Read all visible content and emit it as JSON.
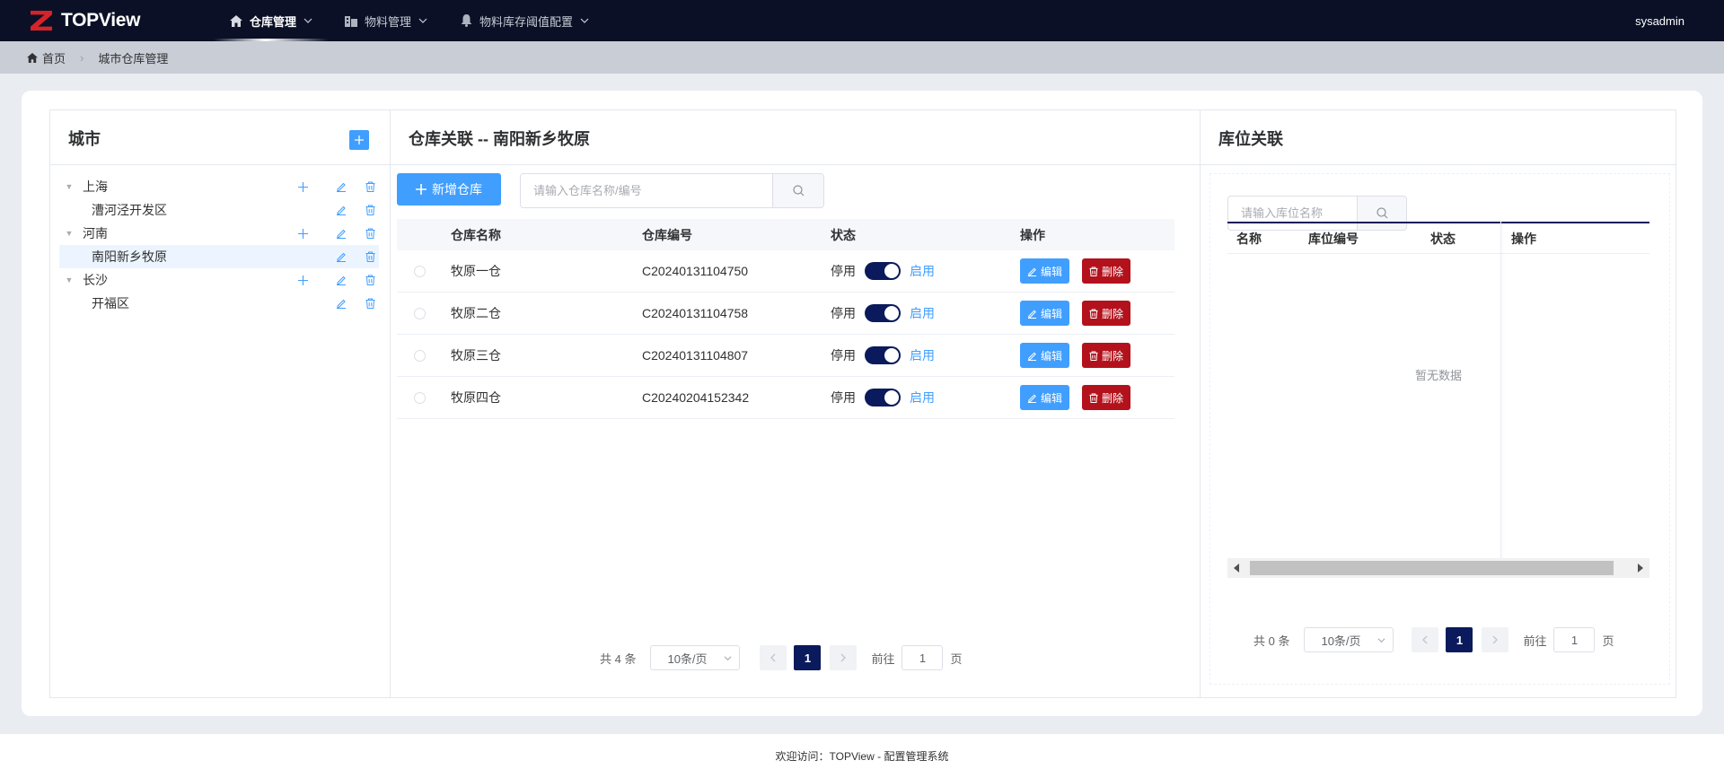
{
  "app": {
    "logo_text": "TOPView",
    "user": "sysadmin"
  },
  "nav": {
    "items": [
      {
        "label": "仓库管理",
        "icon": "home-icon",
        "active": true
      },
      {
        "label": "物料管理",
        "icon": "building-icon",
        "active": false
      },
      {
        "label": "物料库存阈值配置",
        "icon": "bell-icon",
        "active": false
      }
    ]
  },
  "breadcrumb": {
    "home": "首页",
    "current": "城市仓库管理"
  },
  "city_panel": {
    "title": "城市",
    "tree": [
      {
        "label": "上海",
        "level": 0,
        "expanded": true
      },
      {
        "label": "漕河泾开发区",
        "level": 1
      },
      {
        "label": "河南",
        "level": 0,
        "expanded": true
      },
      {
        "label": "南阳新乡牧原",
        "level": 1,
        "selected": true
      },
      {
        "label": "长沙",
        "level": 0,
        "expanded": true
      },
      {
        "label": "开福区",
        "level": 1
      }
    ]
  },
  "warehouse_panel": {
    "title": "仓库关联 -- 南阳新乡牧原",
    "add_button": "新增仓库",
    "search_placeholder": "请输入仓库名称/编号",
    "columns": [
      "仓库名称",
      "仓库编号",
      "状态",
      "操作"
    ],
    "switch_off_label": "停用",
    "switch_on_label": "启用",
    "edit_label": "编辑",
    "delete_label": "删除",
    "rows": [
      {
        "name": "牧原一仓",
        "code": "C20240131104750",
        "enabled": true
      },
      {
        "name": "牧原二仓",
        "code": "C20240131104758",
        "enabled": true
      },
      {
        "name": "牧原三仓",
        "code": "C20240131104807",
        "enabled": true
      },
      {
        "name": "牧原四仓",
        "code": "C20240204152342",
        "enabled": true
      }
    ],
    "pagination": {
      "total": "共 4 条",
      "page_size": "10条/页",
      "current": "1",
      "goto_prefix": "前往",
      "goto_value": "1",
      "goto_suffix": "页"
    }
  },
  "location_panel": {
    "title": "库位关联",
    "search_placeholder": "请输入库位名称",
    "columns": [
      "名称",
      "库位编号",
      "状态",
      "操作"
    ],
    "empty_text": "暂无数据",
    "pagination": {
      "total": "共 0 条",
      "page_size": "10条/页",
      "current": "1",
      "goto_prefix": "前往",
      "goto_value": "1",
      "goto_suffix": "页"
    }
  },
  "footer": {
    "text": "欢迎访问：TOPView - 配置管理系统"
  },
  "colors": {
    "nav_bg": "#0b1026",
    "primary": "#409eff",
    "danger": "#b3121c",
    "accent_dark": "#0b1a5c"
  }
}
